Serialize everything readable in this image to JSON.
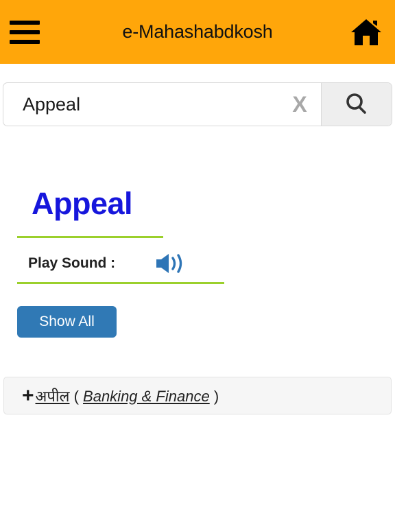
{
  "header": {
    "title": "e-Mahashabdkosh",
    "menu_icon": "hamburger-menu-icon",
    "home_icon": "home-icon",
    "background_color": "#FFA60A"
  },
  "search": {
    "value": "Appeal",
    "placeholder": "Search",
    "clear_label": "X",
    "clear_icon": "close-x-icon",
    "search_icon": "search-magnifier-icon"
  },
  "result": {
    "word": "Appeal",
    "word_color": "#1616DC",
    "divider_color": "#9BD02C",
    "play_sound_label": "Play Sound :",
    "speaker_icon": "speaker-volume-icon",
    "speaker_color": "#3079B5",
    "show_all_label": "Show All",
    "show_all_color": "#3079B5"
  },
  "entries": [
    {
      "expand_icon": "plus-icon",
      "expand_label": "+",
      "term": "अपील",
      "open_paren": "(",
      "category": "Banking & Finance",
      "close_paren": ")"
    }
  ]
}
